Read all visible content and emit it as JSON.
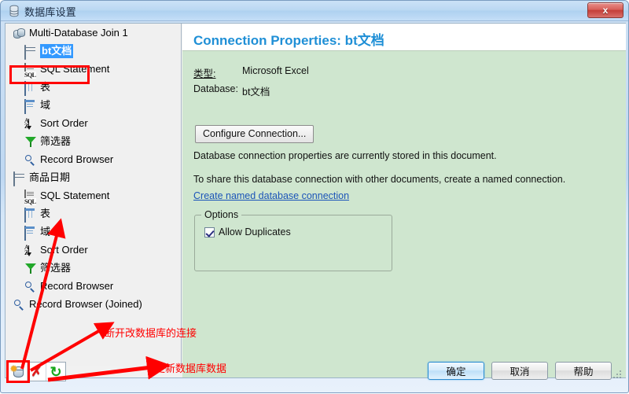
{
  "window": {
    "title": "数据库设置",
    "icon": "database-icon",
    "close_label": "x"
  },
  "sidebar": {
    "tree": [
      {
        "label": "Multi-Database Join 1",
        "icon": "multi-database-icon",
        "level": 0,
        "selected": false
      },
      {
        "label": "bt文档",
        "icon": "database-icon",
        "level": 1,
        "selected": true
      },
      {
        "label": "SQL Statement",
        "icon": "sql-icon",
        "level": 1,
        "selected": false
      },
      {
        "label": "表",
        "icon": "table-icon",
        "level": 1,
        "selected": false
      },
      {
        "label": "域",
        "icon": "field-icon",
        "level": 1,
        "selected": false
      },
      {
        "label": "Sort Order",
        "icon": "sort-order-icon",
        "level": 1,
        "selected": false
      },
      {
        "label": "筛选器",
        "icon": "filter-icon",
        "level": 1,
        "selected": false
      },
      {
        "label": "Record Browser",
        "icon": "search-icon",
        "level": 1,
        "selected": false
      },
      {
        "label": "商品日期",
        "icon": "database-icon",
        "level": 0,
        "selected": false
      },
      {
        "label": "SQL Statement",
        "icon": "sql-icon",
        "level": 1,
        "selected": false
      },
      {
        "label": "表",
        "icon": "table-icon",
        "level": 1,
        "selected": false
      },
      {
        "label": "域",
        "icon": "field-icon",
        "level": 1,
        "selected": false
      },
      {
        "label": "Sort Order",
        "icon": "sort-order-icon",
        "level": 1,
        "selected": false
      },
      {
        "label": "筛选器",
        "icon": "filter-icon",
        "level": 1,
        "selected": false
      },
      {
        "label": "Record Browser",
        "icon": "search-icon",
        "level": 1,
        "selected": false
      },
      {
        "label": "Record Browser (Joined)",
        "icon": "search-icon",
        "level": 0,
        "selected": false
      }
    ],
    "toolbar": [
      {
        "name": "new-database-button",
        "icon": "database-new-icon"
      },
      {
        "name": "delete-database-button",
        "icon": "red-x-icon"
      },
      {
        "name": "refresh-database-button",
        "icon": "green-refresh-icon"
      }
    ]
  },
  "main": {
    "title": "Connection Properties: bt文档",
    "type_label": "类型:",
    "type_value": "Microsoft Excel",
    "database_label": "Database:",
    "database_value": "bt文档",
    "configure_button": "Configure Connection...",
    "description_line1": "Database connection properties are currently stored in this document.",
    "description_line2": "To share this database connection with other documents, create a named connection.",
    "named_connection_link": "Create named database connection",
    "options": {
      "legend": "Options",
      "allow_duplicates_label": "Allow Duplicates",
      "allow_duplicates_checked": true
    }
  },
  "footer": {
    "ok": "确定",
    "cancel": "取消",
    "help": "帮助"
  },
  "annotations": {
    "note_disconnect": "断开改数据库的连接",
    "note_refresh": "更新数据库数据",
    "color": "#ff0000"
  },
  "colors": {
    "accent_title": "#1f8fd6",
    "pane_background": "#cfe6cf",
    "selection": "#3399ff",
    "link": "#1b54b8",
    "annotation": "#ff0000"
  }
}
